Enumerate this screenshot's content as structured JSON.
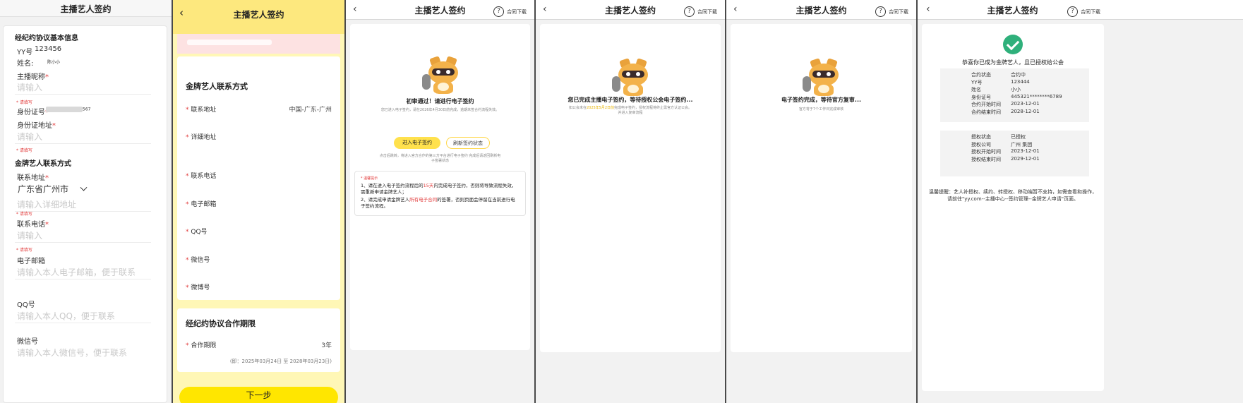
{
  "common": {
    "title": "主播艺人签约",
    "download": "合同下载",
    "help": "?"
  },
  "panel1": {
    "section_basic": "经纪约协议基本信息",
    "yy_label": "YY号",
    "yy_value": "123456",
    "name_label": "姓名:",
    "name_value": "陈小小",
    "nick_label": "主播昵称",
    "nick_placeholder": "请输入",
    "required_tip": "* 请填写",
    "id_label": "身份证号",
    "id_value_tail": "567",
    "idaddr_label": "身份证地址",
    "idaddr_placeholder": "请输入",
    "section_contact": "金牌艺人联系方式",
    "contact_addr_label": "联系地址",
    "contact_addr_value": "广东省广州市",
    "detail_placeholder": "请输入详细地址",
    "phone_label": "联系电话",
    "phone_placeholder": "请输入",
    "email_label": "电子邮箱",
    "email_placeholder": "请输入本人电子邮箱，便于联系",
    "qq_label": "QQ号",
    "qq_placeholder": "请输入本人QQ，便于联系",
    "wechat_label": "微信号",
    "wechat_placeholder": "请输入本人微信号，便于联系"
  },
  "panel2": {
    "section_contact": "金牌艺人联系方式",
    "addr_label": "联系地址",
    "addr_value": "中国-广东-广州",
    "detail_label": "详细地址",
    "phone_label": "联系电话",
    "email_label": "电子邮箱",
    "qq_label": "QQ号",
    "wechat_label": "微信号",
    "weibo_label": "微博号",
    "section_period": "经纪约协议合作期限",
    "period_label": "合作期限",
    "period_value": "3年",
    "period_note": "(即：2025年03月24日 至 2028年03月23日)",
    "next_button": "下一步"
  },
  "panel3": {
    "status_title": "初审通过！请进行电子签约",
    "status_desc": "您已进入电子签约，请在2026年4月30日前完成，逾期未签合约流程失效。",
    "enter_button": "进入电子签约",
    "refresh_button": "刷新签约状态",
    "hint": "点击后跳转，将进入官方合作的第三方平台进行电子签约 完成后请返回刷新电子签署状态",
    "warn_title": "* 温馨提示",
    "warn_1_a": "1、请在进入电子签约流程后的",
    "warn_1_days": "15天",
    "warn_1_b": "内完成电子签约，否则将导致流程失效，需重新申请金牌艺人；",
    "warn_2_a": "2、请完成申请金牌艺人",
    "warn_2_red": "所有电子合同",
    "warn_2_b": "的签署，否则页面会停留在当前进行电子签约流程。"
  },
  "panel4": {
    "status_title": "您已完成主播电子签约，等待授权公会电子签约...",
    "desc_a": "如公会未在",
    "desc_hl": "2025年5月2日前",
    "desc_b": "完成电子签约，授权流程将终止需官方认证公会。并进入复审流程"
  },
  "panel5": {
    "status_title": "电子签约完成，等待官方复审...",
    "desc": "官方将于7个工作日完成审核"
  },
  "panel6": {
    "congrats": "恭喜你已成为金牌艺人，且已授权给公会",
    "contract": [
      {
        "k": "合约状态",
        "v": "合约中"
      },
      {
        "k": "YY号",
        "v": "123444"
      },
      {
        "k": "姓名",
        "v": "小小"
      },
      {
        "k": "身份证号",
        "v": "445321********6789"
      },
      {
        "k": "合约开始时间",
        "v": "2023-12-01"
      },
      {
        "k": "合约结束时间",
        "v": "2028-12-01"
      }
    ],
    "auth": [
      {
        "k": "授权状态",
        "v": "已授权"
      },
      {
        "k": "授权公司",
        "v": "广州 集团"
      },
      {
        "k": "授权开始时间",
        "v": "2023-12-01"
      },
      {
        "k": "授权结束时间",
        "v": "2029-12-01"
      }
    ],
    "tip_1": "温馨提醒：艺人补授权、续约、转授权、移动端暂不支持，如需查看和操作，",
    "tip_2": "请前往\"yy.com--主播中心--签约管理--金牌艺人申请\"页面。"
  },
  "colors": {
    "accent_yellow": "#ffe600",
    "required_red": "#e23b3b",
    "success_green": "#2fb07b"
  }
}
